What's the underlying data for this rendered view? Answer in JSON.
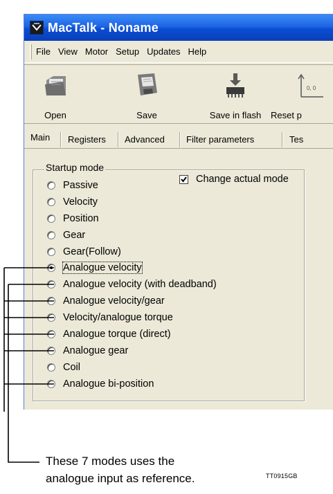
{
  "window": {
    "title": "MacTalk - Noname"
  },
  "menu": [
    "File",
    "View",
    "Motor",
    "Setup",
    "Updates",
    "Help"
  ],
  "toolbar": {
    "open_label": "Open",
    "save_label": "Save",
    "save_flash_label": "Save in flash",
    "reset_label": "Reset p"
  },
  "tabs": [
    "Main",
    "Registers",
    "Advanced",
    "Filter parameters",
    "Tes"
  ],
  "startup_mode": {
    "title": "Startup mode",
    "change_actual_mode": {
      "label": "Change actual mode",
      "checked": true
    },
    "options": [
      {
        "label": "Passive"
      },
      {
        "label": "Velocity"
      },
      {
        "label": "Position"
      },
      {
        "label": "Gear"
      },
      {
        "label": "Gear(Follow)"
      },
      {
        "label": "Analogue velocity",
        "selected": true
      },
      {
        "label": "Analogue velocity (with deadband)"
      },
      {
        "label": "Analogue velocity/gear"
      },
      {
        "label": "Velocity/analogue torque"
      },
      {
        "label": "Analogue torque (direct)"
      },
      {
        "label": "Analogue gear"
      },
      {
        "label": "Coil"
      },
      {
        "label": "Analogue bi-position"
      }
    ]
  },
  "callout": {
    "line1": "These 7 modes uses the",
    "line2": "analogue input as reference."
  },
  "figure_code": "TT0915GB",
  "colors": {
    "titlebar": "#0a4ed4",
    "window_bg": "#ece9d8"
  }
}
